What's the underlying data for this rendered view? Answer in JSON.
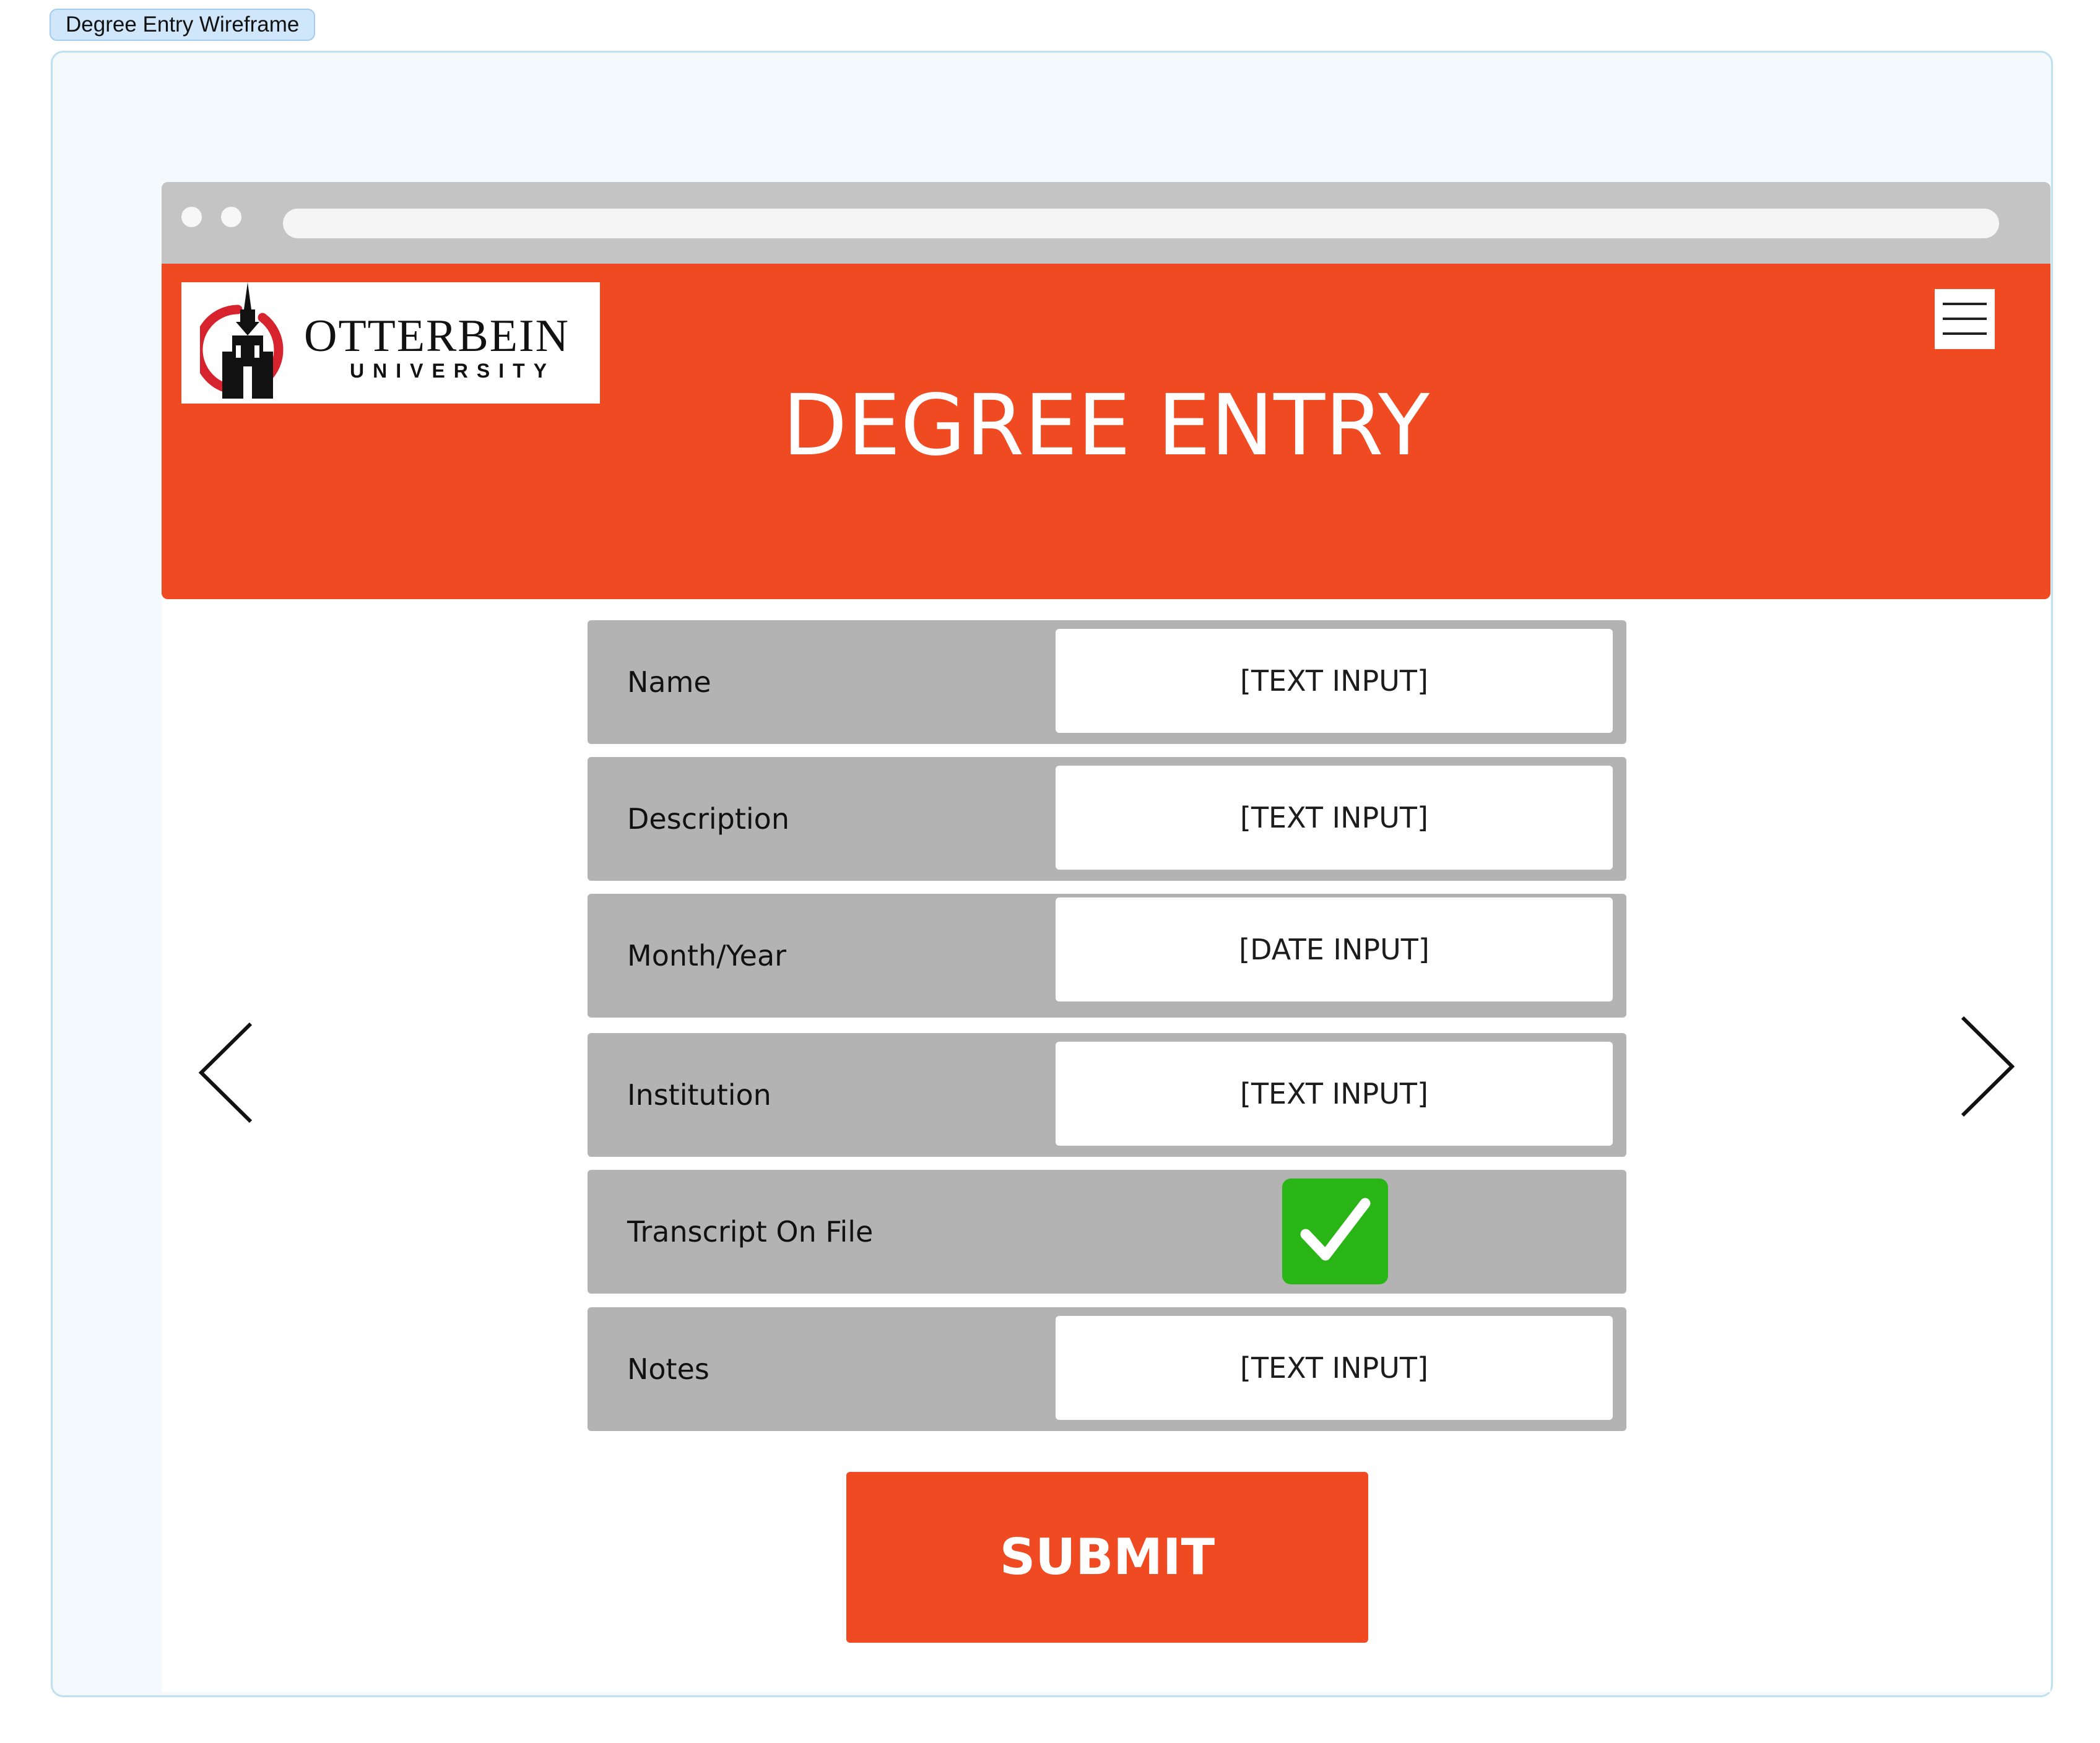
{
  "canvas": {
    "tag_label": "Degree Entry Wireframe"
  },
  "header": {
    "logo": {
      "name": "OTTERBEIN",
      "subtitle": "UNIVERSITY"
    },
    "title": "DEGREE ENTRY",
    "menu_icon": "hamburger-menu-icon"
  },
  "form": {
    "rows": [
      {
        "label": "Name",
        "type": "text",
        "placeholder": "[TEXT INPUT]"
      },
      {
        "label": "Description",
        "type": "text",
        "placeholder": "[TEXT INPUT]"
      },
      {
        "label": "Month/Year",
        "type": "date",
        "placeholder": "[DATE INPUT]"
      },
      {
        "label": "Institution",
        "type": "text",
        "placeholder": "[TEXT INPUT]"
      },
      {
        "label": "Transcript On File",
        "type": "checkbox",
        "checked": true
      },
      {
        "label": "Notes",
        "type": "text",
        "placeholder": "[TEXT INPUT]"
      }
    ],
    "submit_label": "SUBMIT"
  },
  "nav": {
    "prev_icon": "chevron-left-icon",
    "next_icon": "chevron-right-icon"
  },
  "colors": {
    "accent": "#f04a23",
    "row_background": "#b3b3b3",
    "checkbox": "#2ab517",
    "browser_chrome": "#c4c4c4",
    "logo_red": "#d7232d"
  }
}
